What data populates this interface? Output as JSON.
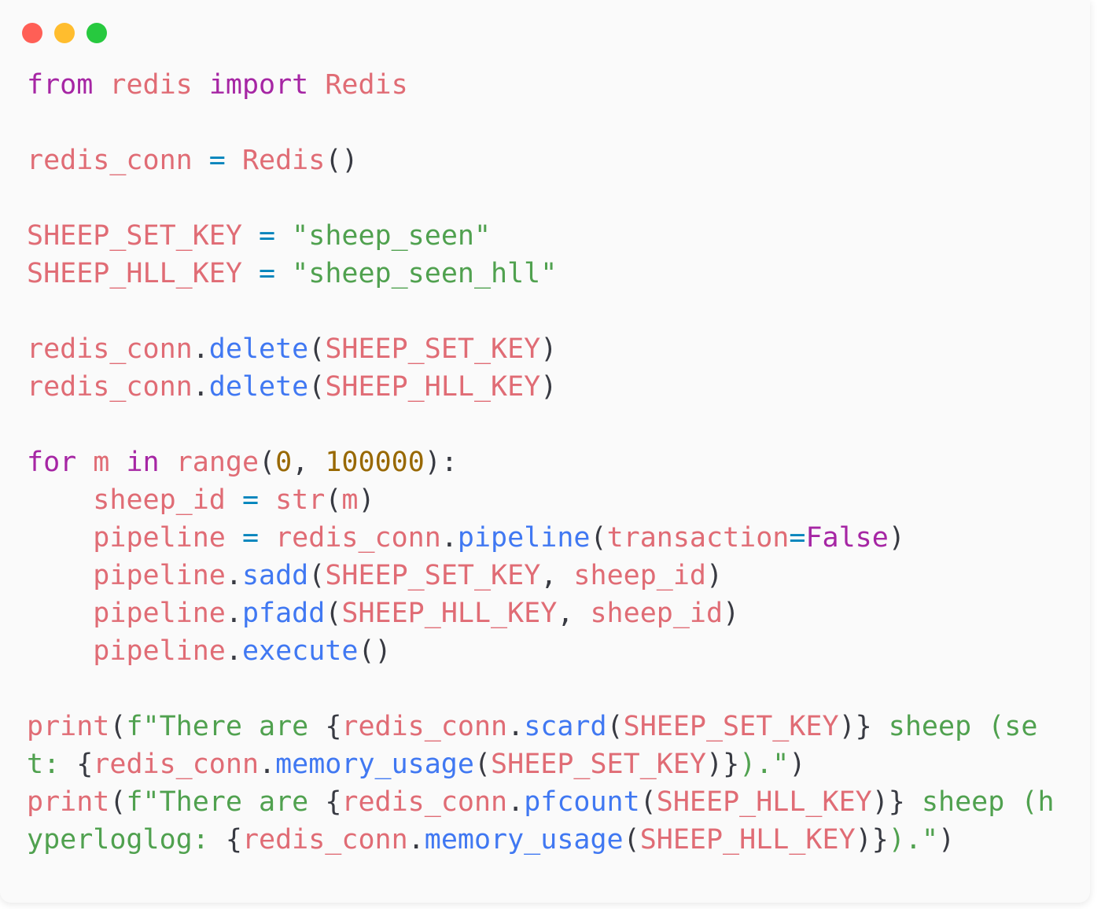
{
  "window": {
    "title": "",
    "background_color": "#fafafa",
    "page_background_color": "#ffffff",
    "traffic_lights": [
      {
        "name": "close",
        "color": "#ff5f56"
      },
      {
        "name": "minimize",
        "color": "#ffbd2e"
      },
      {
        "name": "maximize",
        "color": "#27c93f"
      }
    ]
  },
  "theme": {
    "keyword": "#a626a4",
    "name": "#e06c75",
    "function": "#4078f2",
    "string": "#50a14f",
    "number": "#986801",
    "operator": "#0184bc",
    "punctuation": "#383a42"
  },
  "code": {
    "language": "python",
    "plain_text": "from redis import Redis\n\nredis_conn = Redis()\n\nSHEEP_SET_KEY = \"sheep_seen\"\nSHEEP_HLL_KEY = \"sheep_seen_hll\"\n\nredis_conn.delete(SHEEP_SET_KEY)\nredis_conn.delete(SHEEP_HLL_KEY)\n\nfor m in range(0, 100000):\n    sheep_id = str(m)\n    pipeline = redis_conn.pipeline(transaction=False)\n    pipeline.sadd(SHEEP_SET_KEY, sheep_id)\n    pipeline.pfadd(SHEEP_HLL_KEY, sheep_id)\n    pipeline.execute()\n\nprint(f\"There are {redis_conn.scard(SHEEP_SET_KEY)} sheep (set: {redis_conn.memory_usage(SHEEP_SET_KEY)}).\")\nprint(f\"There are {redis_conn.pfcount(SHEEP_HLL_KEY)} sheep (hyperloglog: {redis_conn.memory_usage(SHEEP_HLL_KEY)}).\")",
    "lines": [
      {
        "n": 1,
        "tokens": [
          {
            "t": "from",
            "c": "kw"
          },
          {
            "t": " ",
            "c": "punct"
          },
          {
            "t": "redis",
            "c": "name"
          },
          {
            "t": " ",
            "c": "punct"
          },
          {
            "t": "import",
            "c": "kw"
          },
          {
            "t": " ",
            "c": "punct"
          },
          {
            "t": "Redis",
            "c": "name"
          }
        ]
      },
      {
        "n": 2,
        "tokens": []
      },
      {
        "n": 3,
        "tokens": [
          {
            "t": "redis_conn",
            "c": "name"
          },
          {
            "t": " ",
            "c": "punct"
          },
          {
            "t": "=",
            "c": "op"
          },
          {
            "t": " ",
            "c": "punct"
          },
          {
            "t": "Redis",
            "c": "name"
          },
          {
            "t": "()",
            "c": "punct"
          }
        ]
      },
      {
        "n": 4,
        "tokens": []
      },
      {
        "n": 5,
        "tokens": [
          {
            "t": "SHEEP_SET_KEY",
            "c": "name"
          },
          {
            "t": " ",
            "c": "punct"
          },
          {
            "t": "=",
            "c": "op"
          },
          {
            "t": " ",
            "c": "punct"
          },
          {
            "t": "\"sheep_seen\"",
            "c": "str"
          }
        ]
      },
      {
        "n": 6,
        "tokens": [
          {
            "t": "SHEEP_HLL_KEY",
            "c": "name"
          },
          {
            "t": " ",
            "c": "punct"
          },
          {
            "t": "=",
            "c": "op"
          },
          {
            "t": " ",
            "c": "punct"
          },
          {
            "t": "\"sheep_seen_hll\"",
            "c": "str"
          }
        ]
      },
      {
        "n": 7,
        "tokens": []
      },
      {
        "n": 8,
        "tokens": [
          {
            "t": "redis_conn",
            "c": "name"
          },
          {
            "t": ".",
            "c": "punct"
          },
          {
            "t": "delete",
            "c": "fn"
          },
          {
            "t": "(",
            "c": "punct"
          },
          {
            "t": "SHEEP_SET_KEY",
            "c": "name"
          },
          {
            "t": ")",
            "c": "punct"
          }
        ]
      },
      {
        "n": 9,
        "tokens": [
          {
            "t": "redis_conn",
            "c": "name"
          },
          {
            "t": ".",
            "c": "punct"
          },
          {
            "t": "delete",
            "c": "fn"
          },
          {
            "t": "(",
            "c": "punct"
          },
          {
            "t": "SHEEP_HLL_KEY",
            "c": "name"
          },
          {
            "t": ")",
            "c": "punct"
          }
        ]
      },
      {
        "n": 10,
        "tokens": []
      },
      {
        "n": 11,
        "tokens": [
          {
            "t": "for",
            "c": "kw"
          },
          {
            "t": " ",
            "c": "punct"
          },
          {
            "t": "m",
            "c": "name"
          },
          {
            "t": " ",
            "c": "punct"
          },
          {
            "t": "in",
            "c": "kw"
          },
          {
            "t": " ",
            "c": "punct"
          },
          {
            "t": "range",
            "c": "name"
          },
          {
            "t": "(",
            "c": "punct"
          },
          {
            "t": "0",
            "c": "num"
          },
          {
            "t": ", ",
            "c": "punct"
          },
          {
            "t": "100000",
            "c": "num"
          },
          {
            "t": "):",
            "c": "punct"
          }
        ]
      },
      {
        "n": 12,
        "tokens": [
          {
            "t": "    ",
            "c": "punct"
          },
          {
            "t": "sheep_id",
            "c": "name"
          },
          {
            "t": " ",
            "c": "punct"
          },
          {
            "t": "=",
            "c": "op"
          },
          {
            "t": " ",
            "c": "punct"
          },
          {
            "t": "str",
            "c": "name"
          },
          {
            "t": "(",
            "c": "punct"
          },
          {
            "t": "m",
            "c": "name"
          },
          {
            "t": ")",
            "c": "punct"
          }
        ]
      },
      {
        "n": 13,
        "tokens": [
          {
            "t": "    ",
            "c": "punct"
          },
          {
            "t": "pipeline",
            "c": "name"
          },
          {
            "t": " ",
            "c": "punct"
          },
          {
            "t": "=",
            "c": "op"
          },
          {
            "t": " ",
            "c": "punct"
          },
          {
            "t": "redis_conn",
            "c": "name"
          },
          {
            "t": ".",
            "c": "punct"
          },
          {
            "t": "pipeline",
            "c": "fn"
          },
          {
            "t": "(",
            "c": "punct"
          },
          {
            "t": "transaction",
            "c": "name"
          },
          {
            "t": "=",
            "c": "op"
          },
          {
            "t": "False",
            "c": "kw"
          },
          {
            "t": ")",
            "c": "punct"
          }
        ]
      },
      {
        "n": 14,
        "tokens": [
          {
            "t": "    ",
            "c": "punct"
          },
          {
            "t": "pipeline",
            "c": "name"
          },
          {
            "t": ".",
            "c": "punct"
          },
          {
            "t": "sadd",
            "c": "fn"
          },
          {
            "t": "(",
            "c": "punct"
          },
          {
            "t": "SHEEP_SET_KEY",
            "c": "name"
          },
          {
            "t": ", ",
            "c": "punct"
          },
          {
            "t": "sheep_id",
            "c": "name"
          },
          {
            "t": ")",
            "c": "punct"
          }
        ]
      },
      {
        "n": 15,
        "tokens": [
          {
            "t": "    ",
            "c": "punct"
          },
          {
            "t": "pipeline",
            "c": "name"
          },
          {
            "t": ".",
            "c": "punct"
          },
          {
            "t": "pfadd",
            "c": "fn"
          },
          {
            "t": "(",
            "c": "punct"
          },
          {
            "t": "SHEEP_HLL_KEY",
            "c": "name"
          },
          {
            "t": ", ",
            "c": "punct"
          },
          {
            "t": "sheep_id",
            "c": "name"
          },
          {
            "t": ")",
            "c": "punct"
          }
        ]
      },
      {
        "n": 16,
        "tokens": [
          {
            "t": "    ",
            "c": "punct"
          },
          {
            "t": "pipeline",
            "c": "name"
          },
          {
            "t": ".",
            "c": "punct"
          },
          {
            "t": "execute",
            "c": "fn"
          },
          {
            "t": "()",
            "c": "punct"
          }
        ]
      },
      {
        "n": 17,
        "tokens": []
      },
      {
        "n": 18,
        "tokens": [
          {
            "t": "print",
            "c": "name"
          },
          {
            "t": "(",
            "c": "punct"
          },
          {
            "t": "f\"There are ",
            "c": "str"
          },
          {
            "t": "{",
            "c": "punct"
          },
          {
            "t": "redis_conn",
            "c": "name"
          },
          {
            "t": ".",
            "c": "punct"
          },
          {
            "t": "scard",
            "c": "fn"
          },
          {
            "t": "(",
            "c": "punct"
          },
          {
            "t": "SHEEP_SET_KEY",
            "c": "name"
          },
          {
            "t": ")",
            "c": "punct"
          },
          {
            "t": "}",
            "c": "punct"
          },
          {
            "t": " sheep (set: ",
            "c": "str"
          },
          {
            "t": "{",
            "c": "punct"
          },
          {
            "t": "redis_conn",
            "c": "name"
          },
          {
            "t": ".",
            "c": "punct"
          },
          {
            "t": "memory_usage",
            "c": "fn"
          },
          {
            "t": "(",
            "c": "punct"
          },
          {
            "t": "SHEEP_SET_KEY",
            "c": "name"
          },
          {
            "t": ")",
            "c": "punct"
          },
          {
            "t": "}",
            "c": "punct"
          },
          {
            "t": ").\"",
            "c": "str"
          },
          {
            "t": ")",
            "c": "punct"
          }
        ]
      },
      {
        "n": 19,
        "tokens": [
          {
            "t": "print",
            "c": "name"
          },
          {
            "t": "(",
            "c": "punct"
          },
          {
            "t": "f\"There are ",
            "c": "str"
          },
          {
            "t": "{",
            "c": "punct"
          },
          {
            "t": "redis_conn",
            "c": "name"
          },
          {
            "t": ".",
            "c": "punct"
          },
          {
            "t": "pfcount",
            "c": "fn"
          },
          {
            "t": "(",
            "c": "punct"
          },
          {
            "t": "SHEEP_HLL_KEY",
            "c": "name"
          },
          {
            "t": ")",
            "c": "punct"
          },
          {
            "t": "}",
            "c": "punct"
          },
          {
            "t": " sheep (hyperloglog: ",
            "c": "str"
          },
          {
            "t": "{",
            "c": "punct"
          },
          {
            "t": "redis_conn",
            "c": "name"
          },
          {
            "t": ".",
            "c": "punct"
          },
          {
            "t": "memory_usage",
            "c": "fn"
          },
          {
            "t": "(",
            "c": "punct"
          },
          {
            "t": "SHEEP_HLL_KEY",
            "c": "name"
          },
          {
            "t": ")",
            "c": "punct"
          },
          {
            "t": "}",
            "c": "punct"
          },
          {
            "t": ").\"",
            "c": "str"
          },
          {
            "t": ")",
            "c": "punct"
          }
        ]
      }
    ]
  }
}
